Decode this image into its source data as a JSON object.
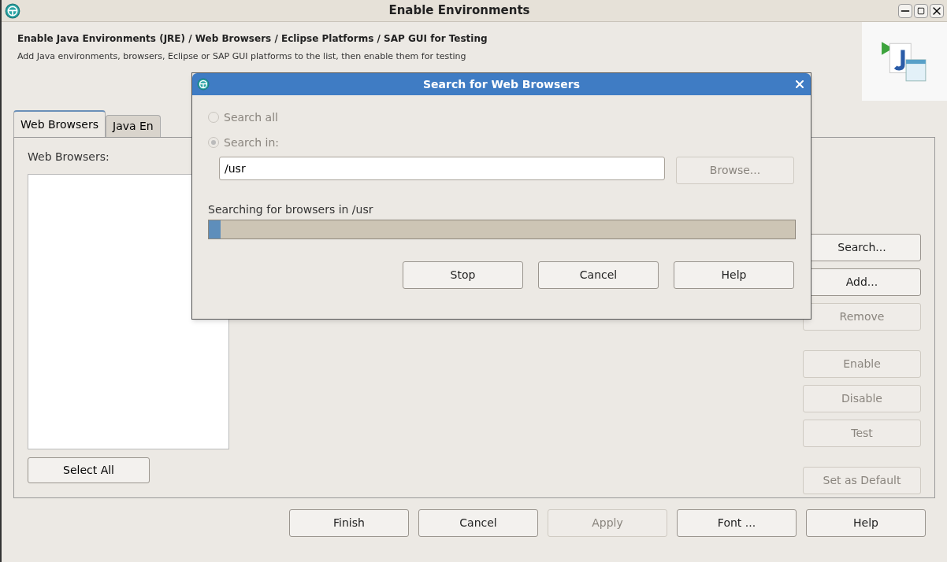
{
  "window": {
    "title": "Enable Environments"
  },
  "header": {
    "title": "Enable Java Environments (JRE) / Web Browsers / Eclipse Platforms / SAP GUI for Testing",
    "description": "Add Java environments, browsers, Eclipse or SAP GUI platforms to the list, then enable them for testing"
  },
  "tabs": [
    {
      "label": "Web Browsers",
      "selected": true
    },
    {
      "label": "Java En",
      "selected": false
    }
  ],
  "panel": {
    "list_label": "Web Browsers:",
    "select_all": "Select All",
    "side_buttons": [
      {
        "label": "Search...",
        "disabled": false,
        "gap_before": false
      },
      {
        "label": "Add...",
        "disabled": false,
        "gap_before": false
      },
      {
        "label": "Remove",
        "disabled": true,
        "gap_before": false
      },
      {
        "label": "Enable",
        "disabled": true,
        "gap_before": true
      },
      {
        "label": "Disable",
        "disabled": true,
        "gap_before": false
      },
      {
        "label": "Test",
        "disabled": true,
        "gap_before": false
      },
      {
        "label": "Set as Default",
        "disabled": true,
        "gap_before": true
      }
    ]
  },
  "footer_buttons": [
    {
      "label": "Finish",
      "disabled": false
    },
    {
      "label": "Cancel",
      "disabled": false
    },
    {
      "label": "Apply",
      "disabled": true
    },
    {
      "label": "Font ...",
      "disabled": false
    },
    {
      "label": "Help",
      "disabled": false
    }
  ],
  "dialog": {
    "title": "Search for Web Browsers",
    "radios": [
      {
        "label": "Search all",
        "selected": false,
        "disabled": true
      },
      {
        "label": "Search in:",
        "selected": true,
        "disabled": true
      }
    ],
    "path": "/usr",
    "browse": {
      "label": "Browse...",
      "disabled": true
    },
    "status": "Searching for browsers in /usr",
    "level": 0.02,
    "buttons": [
      {
        "label": "Stop",
        "disabled": false
      },
      {
        "label": "Cancel",
        "disabled": false
      },
      {
        "label": "Help",
        "disabled": false
      }
    ]
  }
}
